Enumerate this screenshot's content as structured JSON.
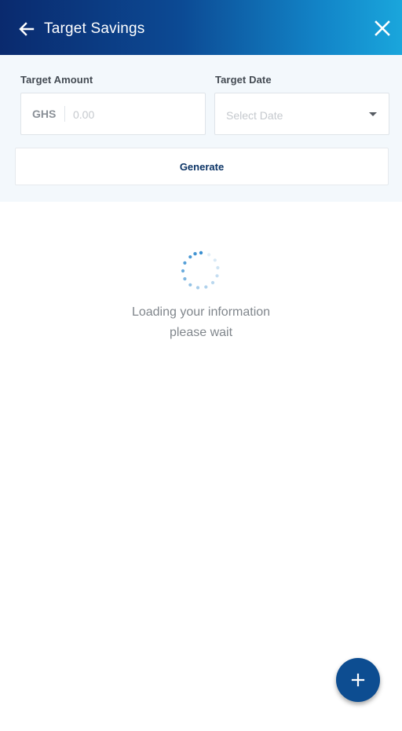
{
  "header": {
    "title": "Target Savings",
    "back_icon": "arrow-left-icon",
    "close_icon": "close-icon"
  },
  "form": {
    "target_amount": {
      "label": "Target Amount",
      "currency": "GHS",
      "value": "",
      "placeholder": "0.00"
    },
    "target_date": {
      "label": "Target Date",
      "placeholder": "Select Date",
      "dropdown_icon": "caret-down-icon"
    },
    "generate_label": "Generate"
  },
  "loading": {
    "line1": "Loading your information",
    "line2": "please wait",
    "icon": "spinner-icon"
  },
  "fab": {
    "icon": "plus-icon"
  },
  "colors": {
    "header_gradient_start": "#0a2a6e",
    "header_gradient_end": "#1aa6dc",
    "form_background": "#f3f8fc",
    "fab": "#0d4d91",
    "spinner": "#3a8fd0"
  }
}
